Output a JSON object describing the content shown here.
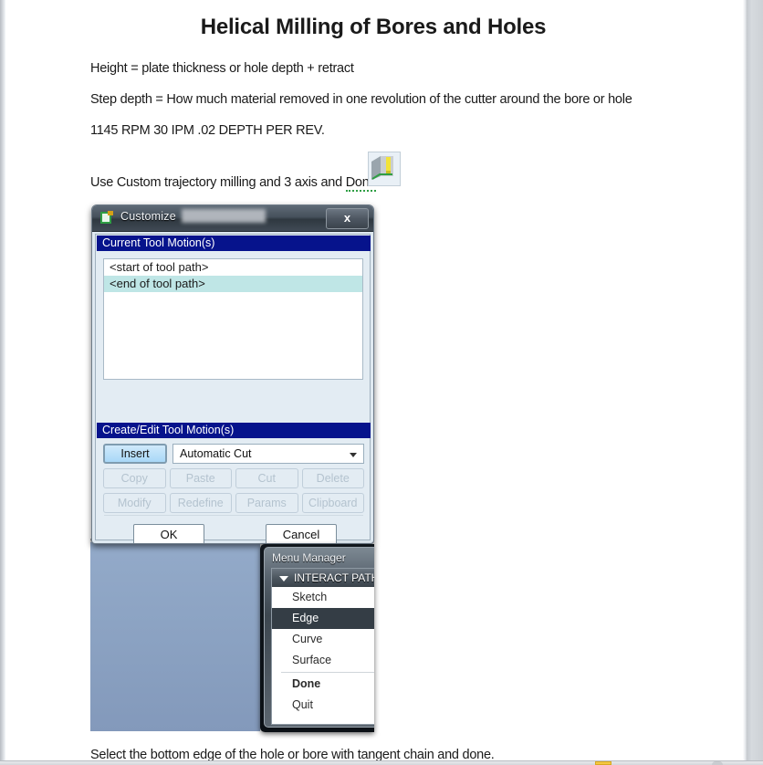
{
  "document": {
    "title": "Helical Milling of Bores and Holes",
    "lines": [
      {
        "id": "height",
        "text": "Height = plate thickness or hole depth + retract"
      },
      {
        "id": "step",
        "text": "Step depth = How much material removed in one revolution of the cutter around the bore or hole"
      },
      {
        "id": "rpm",
        "text": "1145  RPM 30  IPM .02 DEPTH PER REV."
      }
    ],
    "custom_line_prefix": "Use Custom trajectory milling and 3 axis and ",
    "custom_line_spelled": "Done",
    "custom_line_suffix": ".",
    "closing_line": "Select the bottom edge of the hole or bore with tangent chain and done.",
    "icon_name": "trajectory-milling-icon"
  },
  "customize_dialog": {
    "title": "Customize",
    "close_label": "x",
    "sections": {
      "current_motions_header": "Current Tool Motion(s)",
      "create_edit_header": "Create/Edit Tool Motion(s)"
    },
    "motion_list": [
      {
        "label": "<start of tool path>",
        "selected": false
      },
      {
        "label": "<end of tool path>",
        "selected": true
      }
    ],
    "insert_label": "Insert",
    "cut_type_value": "Automatic Cut",
    "cut_type_options": [
      "Automatic Cut"
    ],
    "action_buttons_row1": [
      "Copy",
      "Paste",
      "Cut",
      "Delete"
    ],
    "action_buttons_row2": [
      "Modify",
      "Redefine",
      "Params",
      "Clipboard"
    ],
    "ok_label": "OK",
    "cancel_label": "Cancel",
    "colors": {
      "section_header_bg": "#06138c",
      "selected_row_bg": "#bfe6e6",
      "insert_button_bg": "#a9d8f7"
    }
  },
  "menu_manager": {
    "title": "Menu Manager",
    "header": "INTERACT PATH",
    "items": [
      {
        "label": "Sketch",
        "selected": false,
        "bold": false
      },
      {
        "label": "Edge",
        "selected": true,
        "bold": false
      },
      {
        "label": "Curve",
        "selected": false,
        "bold": false
      },
      {
        "label": "Surface",
        "selected": false,
        "bold": false
      },
      {
        "label": "Done",
        "selected": false,
        "bold": true
      },
      {
        "label": "Quit",
        "selected": false,
        "bold": false
      }
    ],
    "colors": {
      "selected_bg": "#343d45",
      "panel_bg": "#ffffff"
    }
  },
  "graphics_viewport": {
    "name": "creo-graphics-area",
    "background_color": "#8ba2c2"
  }
}
